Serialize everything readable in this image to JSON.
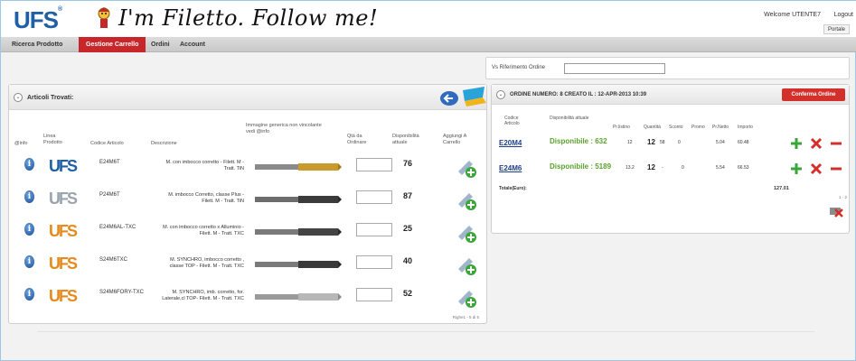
{
  "header": {
    "logo_text": "UFS",
    "logo_tm": "®",
    "tagline": "I'm Filetto. Follow me!",
    "welcome": "Welcome UTENTE7",
    "logout": "Logout",
    "portal": "Portale"
  },
  "nav": {
    "items": [
      {
        "label": "Ricerca Prodotto"
      },
      {
        "label": "Gestione Carrello"
      },
      {
        "label": "Ordini"
      },
      {
        "label": "Account"
      }
    ],
    "active_index": 1
  },
  "reference": {
    "label": "Vs Riferimento Ordine",
    "value": ""
  },
  "articles": {
    "title": "Articoli Trovati:",
    "headers": {
      "info": "@info",
      "line": "Linea Prodotto",
      "code": "Codice Articolo",
      "desc": "Descrizione",
      "image": "Immagine generica non vincolante vedi @info",
      "qty": "Qtà da Ordinare",
      "avail": "Disponibilità attuale",
      "add": "Aggiungi A Carrello"
    },
    "rows": [
      {
        "code": "E24M6T",
        "desc": "M. con imbocco corretto - Filett. M - Tratt. TiN",
        "avail": "76",
        "brand": "UFS",
        "style": "blue",
        "tool": "gold"
      },
      {
        "code": "P24M6T",
        "desc": "M. imbocco Corretto, classe Plus - Filett. M - Tratt. TiN",
        "avail": "87",
        "brand": "UFS",
        "style": "grey",
        "tool": "dark"
      },
      {
        "code": "E24M6AL-TXC",
        "desc": "M. con imbocco corretto x Alluminio - Filett. M - Tratt. TXC",
        "avail": "25",
        "brand": "UFS",
        "style": "orange",
        "tool": "dark"
      },
      {
        "code": "S24M6TXC",
        "desc": "M. SYNCHRO, imbocco corretto , classe TOP - Filett. M - Tratt. TXC",
        "avail": "40",
        "brand": "UFS",
        "style": "orange",
        "tool": "dark"
      },
      {
        "code": "S24M6FORY-TXC",
        "desc": "M. SYNCHRO, imb. corretto, for. Laterale,cl TOP- Filett. M - Tratt. TXC",
        "avail": "52",
        "brand": "UFS",
        "style": "orange",
        "tool": "silver"
      }
    ],
    "pager": "Righe1 - 5 di 5"
  },
  "order": {
    "title": "ORDINE NUMERO: 8 CREATO IL : 12-APR-2013 10:39",
    "confirm": "Conferma Ordine",
    "headers": {
      "code": "Codice Articolo",
      "stock": "Disponibilità attuale",
      "prlistino": "Pr.listino",
      "qty": "Quantità",
      "sconto": "Sconto",
      "promo": "Promo",
      "prnetto": "Pr.Netto",
      "importo": "Importo"
    },
    "rows": [
      {
        "code": "E20M4",
        "stock": "Disponibile : 632",
        "prlistino": "12",
        "qty": "12",
        "sconto": "58",
        "promo": "0",
        "prnetto": "5.04",
        "importo": "60.48"
      },
      {
        "code": "E24M6",
        "stock": "Disponibile : 5189",
        "prlistino": "13.2",
        "qty": "12",
        "sconto": "-",
        "promo": "0",
        "prnetto": "5.54",
        "importo": "66.53"
      }
    ],
    "total_label": "Totale(Euro):",
    "total_value": "127.01",
    "pager": "1 - 2"
  },
  "colors": {
    "accent_red": "#c7262a",
    "brand_blue": "#1e5fa6",
    "stock_green": "#5aa32a"
  },
  "icons": [
    "ufs-logo",
    "mascot-icon",
    "collapse-icon",
    "back-arrow-icon",
    "cart-flag-icon",
    "info-icon",
    "add-to-cart-icon",
    "plus-icon",
    "remove-x-icon",
    "minus-icon",
    "clear-cart-icon"
  ]
}
